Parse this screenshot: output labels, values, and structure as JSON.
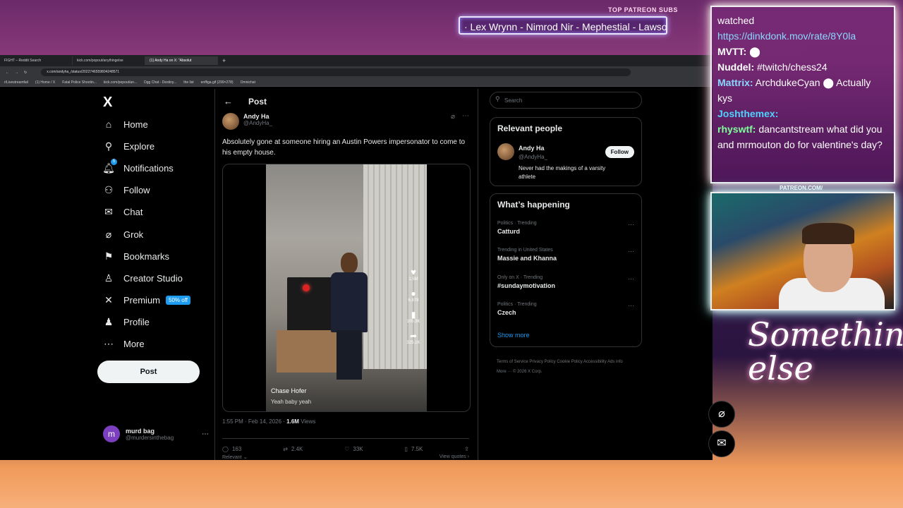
{
  "overlay": {
    "top_label": "TOP PATREON SUBS",
    "subs_ticker": "· Lex Wrynn - Nimrod Nir - Mephestial - Lawsor",
    "patreon_label": "PATREON.COM/",
    "signature": "Something else"
  },
  "browser": {
    "tabs": [
      "FIGHT – Reddit Search",
      "kick.com/popout/anythingelse",
      "(1) Andy Ha on X: \"Absolut"
    ],
    "url": "x.com/andyha_/status/2022746559804248571",
    "bookmarks": [
      "r/Livestreamfail",
      "(1) Home / X",
      "Fatal Police Shootin...",
      "kick.com/popout/an...",
      "Dgg Chat - Destiny...",
      "the list",
      "enffiga.gif (299×278)",
      "Omnichat"
    ]
  },
  "nav": {
    "logo": "X",
    "items": [
      {
        "label": "Home",
        "icon": "home-icon",
        "glyph": "⌂"
      },
      {
        "label": "Explore",
        "icon": "search-icon",
        "glyph": "⚲"
      },
      {
        "label": "Notifications",
        "icon": "bell-icon",
        "glyph": "🔔︎"
      },
      {
        "label": "Follow",
        "icon": "follow-icon",
        "glyph": "⚇"
      },
      {
        "label": "Chat",
        "icon": "mail-icon",
        "glyph": "✉"
      },
      {
        "label": "Grok",
        "icon": "grok-icon",
        "glyph": "⌀"
      },
      {
        "label": "Bookmarks",
        "icon": "bookmark-icon",
        "glyph": "⚑"
      },
      {
        "label": "Creator Studio",
        "icon": "creator-icon",
        "glyph": "♙"
      },
      {
        "label": "Premium",
        "icon": "x-icon",
        "glyph": "✕"
      },
      {
        "label": "Profile",
        "icon": "profile-icon",
        "glyph": "♟"
      },
      {
        "label": "More",
        "icon": "more-icon",
        "glyph": "⋯"
      }
    ],
    "notif_badge": "5",
    "premium_badge": "50% off",
    "post_button": "Post",
    "account": {
      "initial": "m",
      "name": "murd bag",
      "handle": "@murdersinthebag"
    }
  },
  "post": {
    "header": "Post",
    "author": {
      "name": "Andy Ha",
      "handle": "@AndyHa_"
    },
    "text": "Absolutely gone at someone hiring an Austin Powers impersonator to come to his empty house.",
    "video": {
      "caption_name": "Chase Hofer",
      "caption_sub": "Yeah baby yeah",
      "likes": "1.5M",
      "comments": "6,878",
      "saves": "105.3K",
      "shares": "325.1K"
    },
    "timestamp": "1:55 PM · Feb 14, 2026 · ",
    "views": "1.6M",
    "views_label": " Views",
    "actions": {
      "replies": "163",
      "reposts": "2.4K",
      "likes": "33K",
      "bookmarks": "7.5K"
    },
    "below_left": "Relevant ⌄",
    "below_right": "View quotes ›"
  },
  "sidebar": {
    "search_placeholder": "Search",
    "relevant": {
      "title": "Relevant people",
      "name": "Andy Ha",
      "handle": "@AndyHa_",
      "bio": "Never had the makings of a varsity athlete",
      "follow": "Follow"
    },
    "happening": {
      "title": "What’s happening",
      "trends": [
        {
          "context": "Politics · Trending",
          "name": "Catturd"
        },
        {
          "context": "Trending in United States",
          "name": "Massie and Khanna"
        },
        {
          "context": "Only on X · Trending",
          "name": "#sundaymotivation"
        },
        {
          "context": "Politics · Trending",
          "name": "Czech"
        }
      ],
      "show_more": "Show more"
    },
    "footer": "Terms of Service   Privacy Policy   Cookie Policy   Accessibility   Ads info   More ···   © 2026 X Corp."
  },
  "chat": {
    "lines": [
      {
        "user": "",
        "text": "watched"
      },
      {
        "user": "",
        "text": "https://dinkdonk.mov/rate/8Y0la",
        "link": true
      },
      {
        "user": "MVTT:",
        "text": " ⬤"
      },
      {
        "user": "Nuddel:",
        "text": " #twitch/chess24"
      },
      {
        "user": "Mattrix:",
        "text": " ArchdukeCyan ⬤ Actually kys"
      },
      {
        "user": "Joshthemex:",
        "text": ""
      },
      {
        "user": "rhyswtf:",
        "text": " dancantstream what did you and mrmouton do for valentine's day?"
      }
    ]
  },
  "colors": {
    "accent": "#1d9bf0",
    "bg": "#000000",
    "text": "#e7e9ea",
    "muted": "#71767b"
  }
}
